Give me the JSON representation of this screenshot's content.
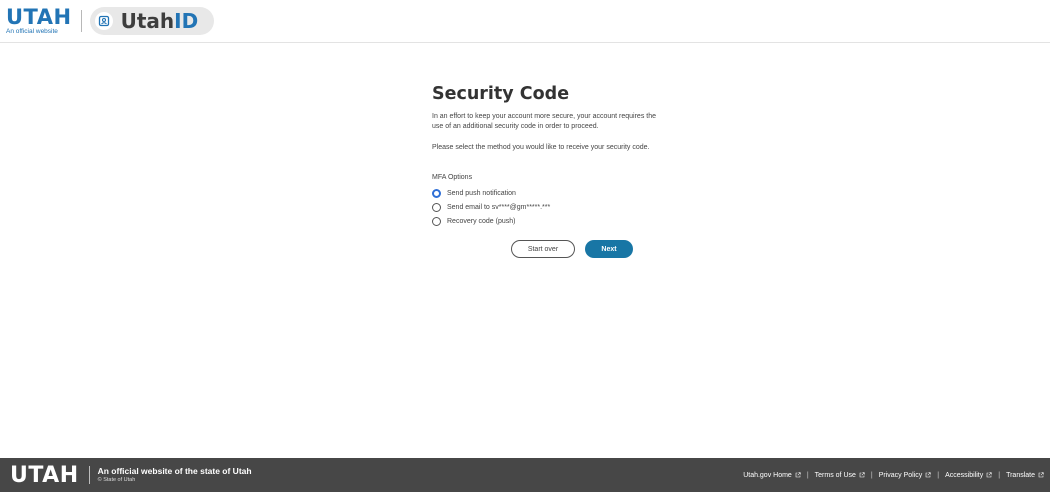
{
  "header": {
    "utah_logo_text": "UTAH",
    "utah_logo_sub": "An official website",
    "app_name_prefix": "Utah",
    "app_name_suffix": "ID"
  },
  "main": {
    "title": "Security Code",
    "paragraph1": "In an effort to keep your account more secure, your account requires the use of an additional security code in order to proceed.",
    "paragraph2": "Please select the method you would like to receive your security code.",
    "mfa_label": "MFA Options",
    "options": [
      {
        "label": "Send push notification",
        "checked": true
      },
      {
        "label": "Send email to sv****@gm*****.***",
        "checked": false
      },
      {
        "label": "Recovery code (push)",
        "checked": false
      }
    ],
    "start_over_label": "Start over",
    "next_label": "Next"
  },
  "footer": {
    "utah_logo_text": "UTAH",
    "official_line": "An official website of the state of Utah",
    "copyright": "© State of Utah",
    "links": [
      {
        "label": "Utah.gov Home"
      },
      {
        "label": "Terms of Use"
      },
      {
        "label": "Privacy Policy"
      },
      {
        "label": "Accessibility"
      },
      {
        "label": "Translate"
      }
    ]
  },
  "colors": {
    "brand_blue": "#2274b5",
    "primary_button": "#1876a5",
    "radio_checked": "#2f6fd6",
    "footer_bg": "#474747"
  }
}
